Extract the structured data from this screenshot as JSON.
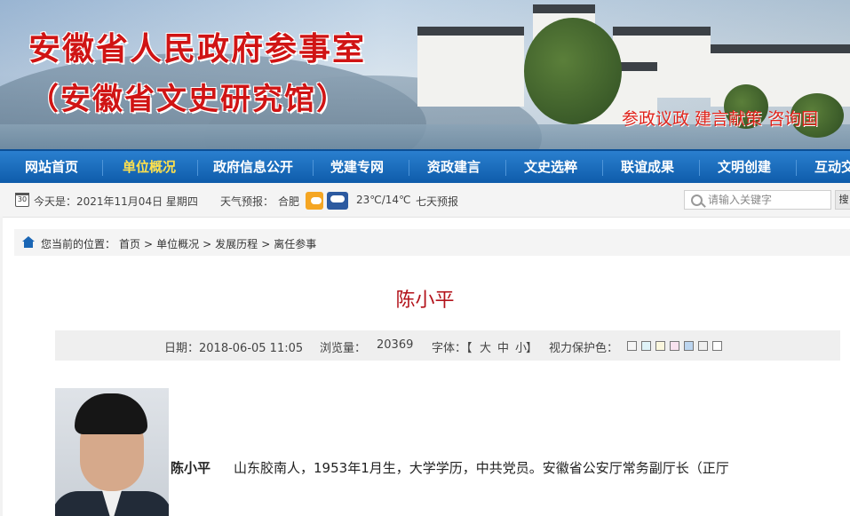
{
  "header": {
    "title_line1": "安徽省人民政府参事室",
    "title_line2": "（安徽省文史研究馆）",
    "slogan": "参政议政 建言献策 咨询国"
  },
  "nav": {
    "items": [
      {
        "label": "网站首页",
        "active": false
      },
      {
        "label": "单位概况",
        "active": true
      },
      {
        "label": "政府信息公开",
        "active": false
      },
      {
        "label": "党建专网",
        "active": false
      },
      {
        "label": "资政建言",
        "active": false
      },
      {
        "label": "文史选粹",
        "active": false
      },
      {
        "label": "联谊成果",
        "active": false
      },
      {
        "label": "文明创建",
        "active": false
      },
      {
        "label": "互动交",
        "active": false
      }
    ]
  },
  "infobar": {
    "calendar_day": "30",
    "date_text": "今天是：2021年11月04日 星期四",
    "weather_label": "天气预报：",
    "city": "合肥",
    "weather_icons": [
      "sun-cloud-icon",
      "rain-cloud-icon"
    ],
    "temperature": "23℃/14℃",
    "forecast_link": "七天预报",
    "search_placeholder": "请输入关键字",
    "search_button": "搜"
  },
  "breadcrumb": {
    "prefix": "您当前的位置：",
    "items": [
      "首页",
      ">",
      "单位概况",
      ">",
      "发展历程",
      ">",
      "离任参事"
    ]
  },
  "article": {
    "title": "陈小平",
    "date": "日期：2018-06-05 11:05",
    "views_label": "浏览量：",
    "views": "20369",
    "font_label": "字体：【",
    "font_large": "大",
    "font_medium": "中",
    "font_small": "小",
    "font_close": "】",
    "eye_care_label": "视力保护色：",
    "swatch_colors": [
      "#f5f5f5",
      "#dff3f8",
      "#fbf7dd",
      "#f9e2ef",
      "#bcd5ef",
      "#efefef",
      "#ffffff"
    ],
    "bio_name": "陈小平",
    "bio_text": "山东胶南人，1953年1月生，大学学历，中共党员。安徽省公安厅常务副厅长（正厅"
  }
}
